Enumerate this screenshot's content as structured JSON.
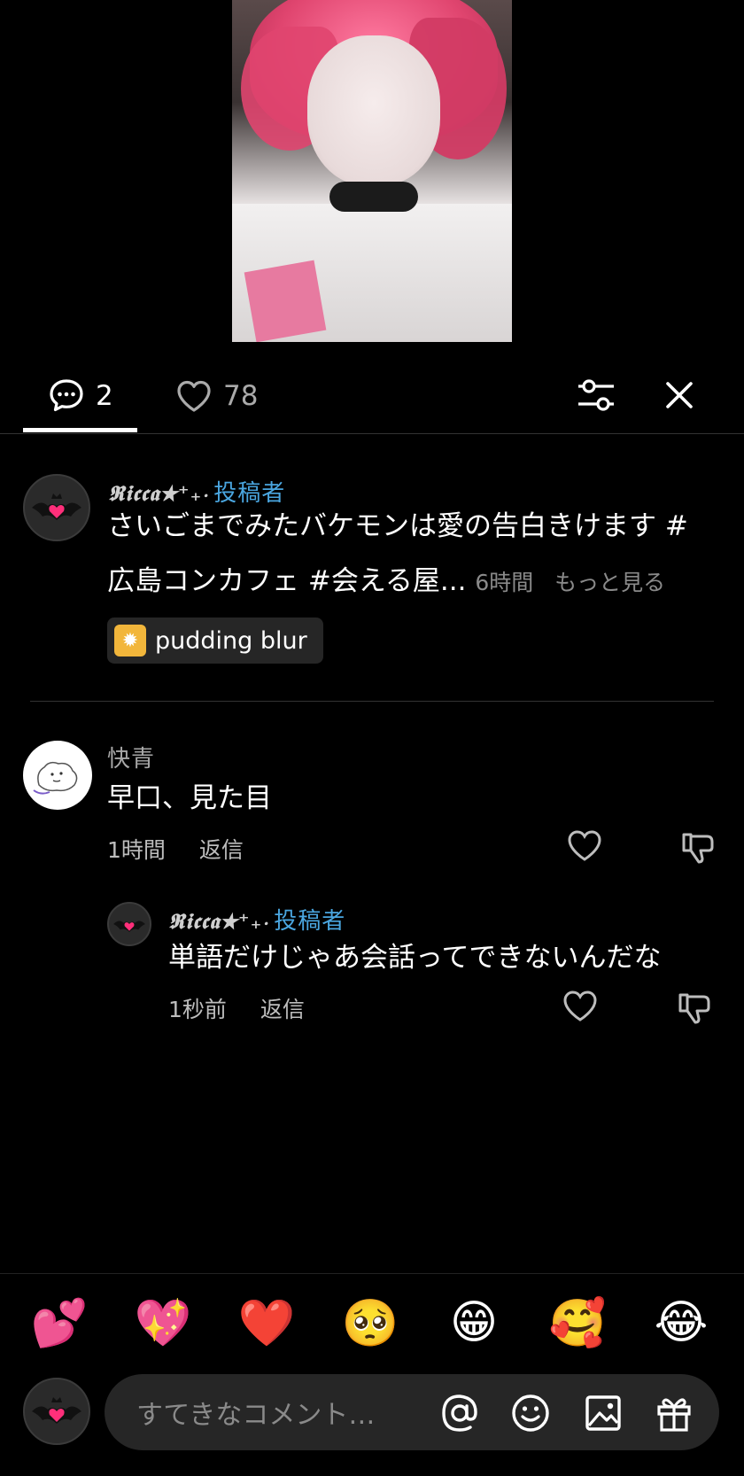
{
  "tabs": {
    "comment_count": "2",
    "like_count": "78"
  },
  "post": {
    "author": "𝕽𝖎𝖈𝖈𝖆★⁺₊‧",
    "author_badge": "投稿者",
    "caption_line1": "さいごまでみたバケモンは愛の告白きけます #",
    "caption_line2": "広島コンカフェ #会える屋...",
    "time": "6時間",
    "see_more": "もっと見る",
    "effect_chip": "pudding blur"
  },
  "comments": [
    {
      "user": "快青",
      "text": "早口、見た目",
      "time": "1時間",
      "reply_label": "返信",
      "replies": [
        {
          "user": "𝕽𝖎𝖈𝖈𝖆★⁺₊‧",
          "badge": "投稿者",
          "text": "単語だけじゃあ会話ってできないんだな",
          "time": "1秒前",
          "reply_label": "返信"
        }
      ]
    }
  ],
  "emoji_bar": [
    "💕",
    "💖",
    "❤️",
    "🥺",
    "😁",
    "🥰",
    "😂"
  ],
  "composer": {
    "placeholder": "すてきなコメント…"
  },
  "colors": {
    "background": "#000000",
    "badge_blue": "#4aa6e0",
    "muted": "#8a8a8a"
  }
}
